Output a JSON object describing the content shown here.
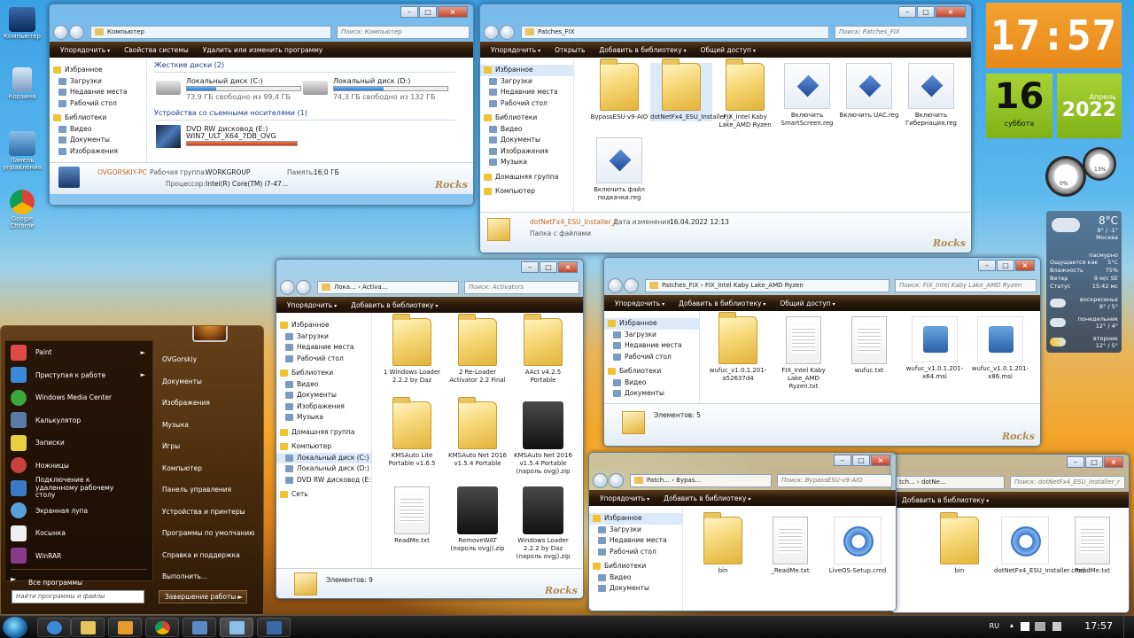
{
  "desktop_icons": [
    {
      "label": "Компьютер"
    },
    {
      "label": "Корзина"
    },
    {
      "label": "Панель управления"
    },
    {
      "label": "Google Chrome"
    }
  ],
  "win_computer": {
    "address": "Компьютер",
    "search": "Поиск: Компьютер",
    "toolbar": [
      "Упорядочить",
      "Свойства системы",
      "Удалить или изменить программу"
    ],
    "nav": [
      "Избранное",
      "Загрузки",
      "Недавние места",
      "Рабочий стол",
      "Библиотеки",
      "Видео",
      "Документы",
      "Изображения"
    ],
    "hdd_group": "Жесткие диски (2)",
    "drive_c_name": "Локальный диск (C:)",
    "drive_c_free": "73,9 ГБ свободно из 99,4 ГБ",
    "drive_c_fill": 0.26,
    "drive_d_name": "Локальный диск (D:)",
    "drive_d_free": "74,3 ГБ свободно из 132 ГБ",
    "drive_d_fill": 0.44,
    "removable_group": "Устройства со съемными носителями (1)",
    "dvd_name": "DVD RW дисковод (E:)",
    "dvd_label": "WIN7_ULT_X64_7DB_OVG",
    "dvd_fill": 1.0,
    "pc_name": "OVGORSKIY-PC",
    "workgroup_label": "Рабочая группа:",
    "workgroup": "WORKGROUP",
    "memory_label": "Память:",
    "memory": "16,0 ГБ",
    "cpu_label": "Процессор:",
    "cpu": "Intel(R) Core(TM) i7-47..."
  },
  "win_patches": {
    "address": "Patches_FIX",
    "search": "Поиск: Patches_FIX",
    "toolbar": [
      "Упорядочить",
      "Открыть",
      "Добавить в библиотеку",
      "Общий доступ"
    ],
    "nav": [
      "Избранное",
      "Загрузки",
      "Недавние места",
      "Рабочий стол",
      "Библиотеки",
      "Видео",
      "Документы",
      "Изображения",
      "Музыка",
      "Домашняя группа",
      "Компьютер"
    ],
    "items": [
      {
        "name": "BypassESU-v9-AIO",
        "kind": "folder"
      },
      {
        "name": "dotNetFx4_ESU_Installer_r",
        "kind": "folder"
      },
      {
        "name": "FIX_Intel Kaby Lake_AMD Ryzen",
        "kind": "folder"
      },
      {
        "name": "Включить SmartScreen.reg",
        "kind": "reg"
      },
      {
        "name": "Включить UAC.reg",
        "kind": "reg"
      },
      {
        "name": "Включить Гибернация.reg",
        "kind": "reg"
      },
      {
        "name": "Включить файл подкачки.reg",
        "kind": "reg"
      }
    ],
    "detail_name": "dotNetFx4_ESU_Installer_r",
    "detail_date_label": "Дата изменения:",
    "detail_date": "16.04.2022 12:13",
    "detail_type": "Папка с файлами"
  },
  "win_activators": {
    "address": "Лока... › Activa...",
    "search": "Поиск: Activators",
    "toolbar": [
      "Упорядочить",
      "Добавить в библиотеку"
    ],
    "nav": [
      "Избранное",
      "Загрузки",
      "Недавние места",
      "Рабочий стол",
      "Библиотеки",
      "Видео",
      "Документы",
      "Изображения",
      "Музыка",
      "Домашняя группа",
      "Компьютер",
      "Локальный диск (C:)",
      "Локальный диск (D:)",
      "DVD RW дисковод (E:)",
      "Сеть"
    ],
    "items": [
      {
        "name": "1 Windows Loader 2.2.2 by Daz",
        "kind": "folder"
      },
      {
        "name": "2 Re-Loader Activator 2.2 Final",
        "kind": "folder"
      },
      {
        "name": "AAct v4.2.5 Portable",
        "kind": "folder"
      },
      {
        "name": "KMSAuto Lite Portable v1.6.5",
        "kind": "folder"
      },
      {
        "name": "KMSAuto Net 2016 v1.5.4 Portable",
        "kind": "folder"
      },
      {
        "name": "KMSAuto Net 2016 v1.5.4 Portable (пароль ovgj).zip",
        "kind": "box"
      },
      {
        "name": "ReadMe.txt",
        "kind": "txt"
      },
      {
        "name": "RemoveWAT (пароль ovgj).zip",
        "kind": "box"
      },
      {
        "name": "Windows Loader 2.2.2 by Daz (пароль ovgj).zip",
        "kind": "box"
      }
    ],
    "status": "Элементов: 9"
  },
  "win_fix": {
    "address": "Patches_FIX › FIX_Intel Kaby Lake_AMD Ryzen",
    "search": "Поиск: FIX_Intel Kaby Lake_AMD Ryzen",
    "toolbar": [
      "Упорядочить",
      "Добавить в библиотеку",
      "Общий доступ"
    ],
    "nav": [
      "Избранное",
      "Загрузки",
      "Недавние места",
      "Рабочий стол",
      "Библиотеки",
      "Видео",
      "Документы"
    ],
    "items": [
      {
        "name": "wufuc_v1.0.1.201-a52637d4",
        "kind": "folder"
      },
      {
        "name": "FIX_Intel Kaby Lake_AMD Ryzen.txt",
        "kind": "txt"
      },
      {
        "name": "wufuc.txt",
        "kind": "txt"
      },
      {
        "name": "wufuc_v1.0.1.201-x64.msi",
        "kind": "msi"
      },
      {
        "name": "wufuc_v1.0.1.201-x86.msi",
        "kind": "msi"
      }
    ],
    "status": "Элементов: 5"
  },
  "win_bypass": {
    "address": "Patch... › Bypas...",
    "search": "Поиск: BypassESU-v9-AIO",
    "toolbar": [
      "Упорядочить",
      "Добавить в библиотеку"
    ],
    "nav": [
      "Избранное",
      "Загрузки",
      "Недавние места",
      "Рабочий стол",
      "Библиотеки",
      "Видео",
      "Документы"
    ],
    "items": [
      {
        "name": "bin",
        "kind": "folder"
      },
      {
        "name": "_ReadMe.txt",
        "kind": "txt"
      },
      {
        "name": "LiveOS-Setup.cmd",
        "kind": "cmd"
      }
    ]
  },
  "win_dotnet": {
    "address": "tch... › dotNe...",
    "search": "Поиск: dotNetFx4_ESU_Installer_r",
    "toolbar": [
      "Добавить в библиотеку"
    ],
    "items": [
      {
        "name": "bin",
        "kind": "folder"
      },
      {
        "name": "dotNetFx4_ESU_Installer.cmd",
        "kind": "cmd"
      },
      {
        "name": "ReadMe.txt",
        "kind": "txt"
      }
    ]
  },
  "start_menu": {
    "left_items": [
      {
        "label": "Paint",
        "sub": true,
        "color": "#e04a4a"
      },
      {
        "label": "Приступая к работе",
        "sub": true,
        "color": "#3a8ad8"
      },
      {
        "label": "Windows Media Center",
        "sub": false,
        "color": "#3aa83a"
      },
      {
        "label": "Калькулятор",
        "sub": false,
        "color": "#5a7aa8"
      },
      {
        "label": "Записки",
        "sub": false,
        "color": "#e8d040"
      },
      {
        "label": "Ножницы",
        "sub": false,
        "color": "#c84040"
      },
      {
        "label": "Подключение к удаленному рабочему столу",
        "sub": false,
        "color": "#3a7ac8"
      },
      {
        "label": "Экранная лупа",
        "sub": false,
        "color": "#5aa0d8"
      },
      {
        "label": "Косынка",
        "sub": false,
        "color": "#f0f0f0"
      },
      {
        "label": "WinRAR",
        "sub": false,
        "color": "#8a3a8a"
      }
    ],
    "all_programs": "Все программы",
    "right_items": [
      "OVGorskiy",
      "Документы",
      "Изображения",
      "Музыка",
      "Игры",
      "Компьютер",
      "Панель управления",
      "Устройства и принтеры",
      "Программы по умолчанию",
      "Справка и поддержка",
      "Выполнить..."
    ],
    "search_placeholder": "Найти программы и файлы",
    "shutdown": "Завершение работы"
  },
  "gadgets": {
    "time": "17:57",
    "day": "16",
    "weekday": "суббота",
    "month": "Апрель",
    "year": "2022",
    "meter1": "0%",
    "meter2": "13%",
    "weather_temp": "8°C",
    "weather_range": "9° / -1°",
    "weather_city": "Москва",
    "weather_cond": "пасмурно",
    "weather_rows": [
      {
        "k": "Ощущается как",
        "v": "5°C"
      },
      {
        "k": "Влажность",
        "v": "75%"
      },
      {
        "k": "Ветер",
        "v": "9 м/с SE"
      },
      {
        "k": "Статус",
        "v": "15:42 мс"
      }
    ],
    "forecast": [
      {
        "day": "воскресенье",
        "t": "8° / 5°"
      },
      {
        "day": "понедельник",
        "t": "12° / 4°"
      },
      {
        "day": "вторник",
        "t": "12° / 5°"
      }
    ]
  },
  "taskbar": {
    "lang": "RU",
    "time": "17:57",
    "colors": {
      "accent": "#1a6ab0"
    }
  }
}
